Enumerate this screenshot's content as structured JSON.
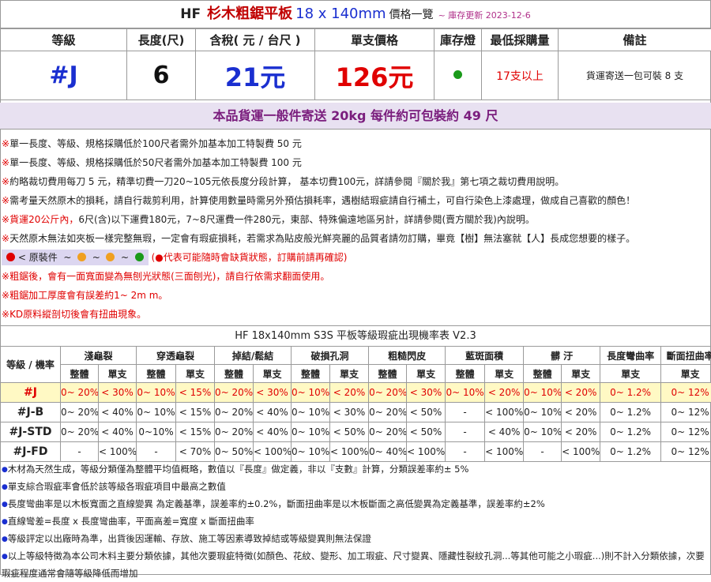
{
  "title": {
    "brand": "HF",
    "product": "杉木粗鋸平板",
    "size": "18 x 140mm",
    "list": "價格一覽",
    "updated": "~ 庫存更新 2023-12-6"
  },
  "top_table": {
    "headers": [
      "等級",
      "長度(尺)",
      "含稅( 元 / 台尺 )",
      "單支價格",
      "庫存燈",
      "最低採購量",
      "備註"
    ],
    "grade": "#J",
    "length": "6",
    "price_per_ft": "21元",
    "unit_price": "126元",
    "stock_color": "#1a9a1a",
    "min_qty": "17支以上",
    "remark": "貨運寄送一包可裝 8 支"
  },
  "shipping_banner": "本品貨運一般件寄送 20kg 每件約可包裝約 49 尺",
  "notes": [
    {
      "mark": "※",
      "text": "單一長度、等級、規格採購低於100尺者需外加基本加工特製費 50 元",
      "red": false
    },
    {
      "mark": "※",
      "text": "單一長度、等級、規格採購低於50尺者需外加基本加工特製費 100 元",
      "red": false
    },
    {
      "mark": "※",
      "text": "約略裁切費用每刀 5 元，精準切費一刀20~105元依長度分段計算， 基本切費100元，詳請參閱『關於我』第七項之裁切費用說明。",
      "red": false
    },
    {
      "mark": "※",
      "text": "需考量天然原木的損耗，請自行裁剪利用，計算使用數量時需另外預估損耗率，遇樹結瑕疵請自行補土，可自行染色上漆處理，做成自己喜歡的顏色！",
      "red": false
    },
    {
      "mark": "※",
      "text_red": "貨運20公斤內，",
      "text": "6尺(含)以下運費180元，7~8尺運費一件280元，東部、特殊偏遠地區另計，詳請參閱(賣方關於我)內說明。",
      "red": false
    },
    {
      "mark": "※",
      "text": "天然原木無法如夾板一樣完整無瑕，一定會有瑕疵損耗，若需求為貼皮般光鮮亮麗的品質者請勿訂購，畢竟【樹】無法塞就【人】長成您想要的樣子。",
      "red": false
    }
  ],
  "legend": {
    "label": "< 原裝件",
    "tilde": "~",
    "note": "(●代表可能隨時會缺貨狀態，訂購前請再確認)",
    "dots": [
      "#e00000",
      "#f0a020",
      "#f0a020",
      "#1a9a1a"
    ]
  },
  "notes2": [
    {
      "mark": "※",
      "text": "粗鋸後，會有一面寬面變為無刨光狀態(三面刨光)，請自行依需求翻面使用。"
    },
    {
      "mark": "※",
      "text": "粗鋸加工厚度會有誤差約1~ 2m m。"
    },
    {
      "mark": "※",
      "text": "KD原料縱剖切後會有扭曲現象。"
    }
  ],
  "defect_table": {
    "title": "HF 18x140mm S3S 平板等級瑕疵出現機率表 V2.3",
    "corner": "等級 / 機率",
    "groups": [
      "淺龜裂",
      "穿透龜裂",
      "掉結/鬆結",
      "破損孔洞",
      "粗糙閃皮",
      "藍斑面積",
      "髒 汙",
      "長度彎曲率",
      "斷面扭曲率"
    ],
    "sub_whole": "整體",
    "sub_single": "單支",
    "rows": [
      {
        "grade": "#J",
        "highlight": true,
        "cells": [
          "0~ 20%",
          "< 30%",
          "0~ 10%",
          "< 15%",
          "0~ 20%",
          "< 30%",
          "0~ 10%",
          "< 20%",
          "0~ 20%",
          "< 30%",
          "0~ 10%",
          "< 20%",
          "0~ 10%",
          "< 20%",
          "0~ 1.2%",
          "0~ 12%"
        ]
      },
      {
        "grade": "#J-B",
        "highlight": false,
        "cells": [
          "0~ 20%",
          "< 40%",
          "0~ 10%",
          "< 15%",
          "0~ 20%",
          "< 40%",
          "0~ 10%",
          "< 30%",
          "0~ 20%",
          "< 50%",
          "-",
          "< 100%",
          "0~ 10%",
          "< 20%",
          "0~ 1.2%",
          "0~ 12%"
        ]
      },
      {
        "grade": "#J-STD",
        "highlight": false,
        "cells": [
          "0~ 20%",
          "< 40%",
          "0~10%",
          "< 15%",
          "0~ 20%",
          "< 40%",
          "0~ 10%",
          "< 50%",
          "0~ 20%",
          "< 50%",
          "-",
          "< 40%",
          "0~ 10%",
          "< 20%",
          "0~ 1.2%",
          "0~ 12%"
        ]
      },
      {
        "grade": "#J-FD",
        "highlight": false,
        "cells": [
          "-",
          "< 100%",
          "-",
          "< 70%",
          "0~ 50%",
          "< 100%",
          "0~ 10%",
          "< 100%",
          "0~ 40%",
          "< 100%",
          "-",
          "< 100%",
          "-",
          "< 100%",
          "0~ 1.2%",
          "0~ 12%"
        ]
      }
    ]
  },
  "footnotes": [
    "木材為天然生成，等級分類僅為整體平均值概略，數值以『長度』做定義，非以『支數』計算，分類誤差率約± 5%",
    "單支綜合瑕疵率會低於該等級各瑕疵項目中最高之數值",
    "長度彎曲率是以木板寬面之直線變異 為定義基準，誤差率約±0.2%，斷面扭曲率是以木板斷面之高低變異為定義基準，誤差率約±2%",
    "直線彎差=長度 x 長度彎曲率，平面高差=寬度 x 斷面扭曲率",
    "等級評定以出廠時為準，出貨後因運輸、存放、施工等因素導致掉結或等級變異則無法保證",
    "以上等級特徵為本公司木料主要分類依據，其他次要瑕疵特徵(如顏色、花紋、變形、加工瑕疵、尺寸變異、隱藏性裂紋孔洞...等其他可能之小瑕疵...)則不計入分類依據，次要瑕疵程度通常會隨等級降低而增加"
  ]
}
